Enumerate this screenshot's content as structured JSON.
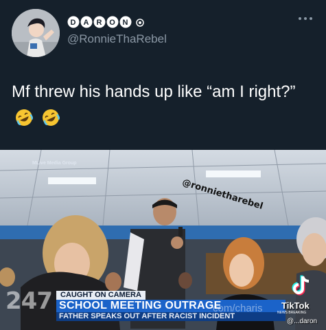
{
  "tweet": {
    "display_name": "DARON",
    "handle": "@RonnieThaRebel",
    "text": "Mf threw his hands up like “am I right?”",
    "emoji": [
      "rolling-on-floor-laughing",
      "rolling-on-floor-laughing"
    ]
  },
  "media": {
    "source_tag": "MLive Media Group",
    "overlay_handle": "@ronnietharebel",
    "lower_third": {
      "tag": "CAUGHT ON CAMERA",
      "headline": "SCHOOL MEETING OUTRAGE",
      "subhead": "FATHER SPEAKS OUT AFTER RACIST INCIDENT"
    },
    "watermark_number": "247",
    "watermark_url": "com/charis",
    "news_tag": "NEWS BREAKING",
    "tiktok": {
      "name": "TikTok",
      "user": "@...daron"
    }
  },
  "colors": {
    "background": "#15202b",
    "handle_gray": "#8b98a5",
    "headline_blue": "#1b63c9",
    "subhead_blue": "#0e3d85"
  }
}
